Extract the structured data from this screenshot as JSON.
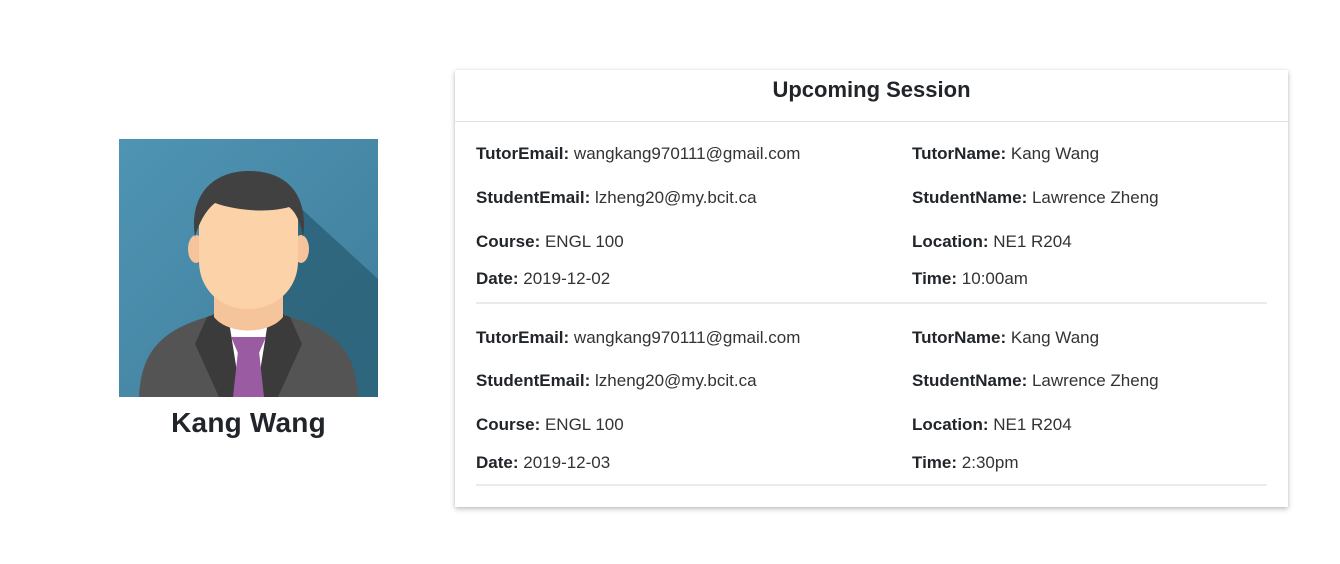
{
  "profile": {
    "name": "Kang Wang",
    "avatar_icon": "person-avatar-icon",
    "avatar_bg": "#4a8fae"
  },
  "upcoming": {
    "title": "Upcoming Session",
    "labels": {
      "tutor_email": "TutorEmail:",
      "tutor_name": "TutorName:",
      "student_email": "StudentEmail:",
      "student_name": "StudentName:",
      "course": "Course:",
      "location": "Location:",
      "date": "Date:",
      "time": "Time:"
    },
    "sessions": [
      {
        "tutor_email": "wangkang970111@gmail.com",
        "tutor_name": "Kang Wang",
        "student_email": "lzheng20@my.bcit.ca",
        "student_name": "Lawrence Zheng",
        "course": "ENGL 100",
        "location": "NE1 R204",
        "date": "2019-12-02",
        "time": "10:00am"
      },
      {
        "tutor_email": "wangkang970111@gmail.com",
        "tutor_name": "Kang Wang",
        "student_email": "lzheng20@my.bcit.ca",
        "student_name": "Lawrence Zheng",
        "course": "ENGL 100",
        "location": "NE1 R204",
        "date": "2019-12-03",
        "time": "2:30pm"
      }
    ]
  }
}
